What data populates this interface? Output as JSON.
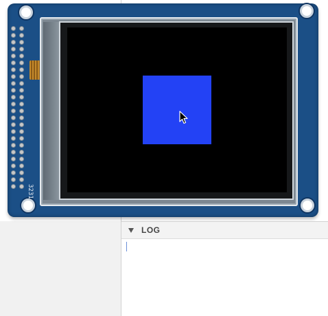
{
  "simulator": {
    "board_label": "3231",
    "screen_background": "#000000",
    "drawn_rect_color": "#2342f5",
    "board_color": "#1b4f86",
    "cursor_icon": "arrow-cursor-icon"
  },
  "log_panel": {
    "title": "LOG",
    "collapse_icon": "triangle-down-icon",
    "content": ""
  }
}
